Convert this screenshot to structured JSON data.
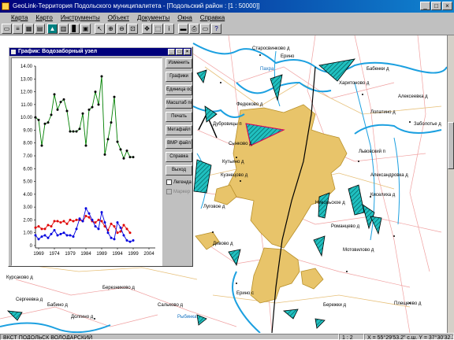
{
  "window": {
    "title": "GeoLink-Территория Подольского муниципалитета - [Подольский район : [1 : 50000]]",
    "buttons": [
      "_",
      "□",
      "×"
    ]
  },
  "menu": [
    "Карта",
    "Карто",
    "Инструменты",
    "Объект",
    "Документы",
    "Окна",
    "Справка"
  ],
  "graph_window": {
    "title": "График: Водозаборный узел",
    "buttons": [
      {
        "name": "edit-button",
        "label": "Изменить"
      },
      {
        "name": "charts-button",
        "label": "Графики"
      },
      {
        "name": "y-units-button",
        "label": "Единица оси Y"
      },
      {
        "name": "x-scale-button",
        "label": "Масштаб по X"
      },
      {
        "name": "print-button",
        "label": "Печать"
      },
      {
        "name": "metafile-button",
        "label": "Метафайл"
      },
      {
        "name": "bmp-file-button",
        "label": "BMP файл"
      },
      {
        "name": "help-button",
        "label": "Справка"
      },
      {
        "name": "exit-button",
        "label": "Выход"
      }
    ],
    "legend_label": "Легенда",
    "marker_label": "Маркер"
  },
  "map_labels": [
    "Старосвинково д",
    "Ерино",
    "Бабенки д",
    "Алексеевка д",
    "Харитоново д",
    "Федюково д",
    "Лопатино д",
    "Дубровицы п",
    "Заболотье д",
    "Львовский п",
    "Сынково д",
    "Кутьино д",
    "Александровка д",
    "Киселиха д",
    "Кузнецово д",
    "Луговое д",
    "Романцево д",
    "Мотовилово д",
    "Дивово д",
    "Плещеево д",
    "Бережки д",
    "Березниково д",
    "Сальково д",
    "Сергеевка д",
    "Ерино с",
    "Курсаково д",
    "Долгино д",
    "Бабино д",
    "Пахра",
    "Рыбинка",
    "Никольское д"
  ],
  "status": {
    "region": "ВКСТ ПОДОЛЬСК ВОЛОДАРСКИЙ",
    "scale": "1 : 2",
    "coords": "X = 55°29'53.2\" с.ш.   Y = 37°30'32.3\" в.д."
  },
  "chart_data": {
    "type": "line",
    "x_ticks": [
      "1969",
      "1974",
      "1979",
      "1984",
      "1989",
      "1994",
      "1999",
      "2004"
    ],
    "y_ticks": [
      "0",
      "1.00",
      "2.00",
      "3.00",
      "4.00",
      "5.00",
      "6.00",
      "7.00",
      "8.00",
      "9.00",
      "10.00",
      "11.00",
      "12.00",
      "13.00",
      "14.00"
    ],
    "ylim": [
      0,
      14
    ],
    "xlim": [
      1968,
      2005
    ],
    "grid": false,
    "series": [
      {
        "color": "#008000",
        "x": [
          1968,
          1969,
          1970,
          1971,
          1972,
          1973,
          1974,
          1975,
          1976,
          1977,
          1978,
          1979,
          1980,
          1981,
          1982,
          1983,
          1984,
          1985,
          1986,
          1987,
          1988,
          1989,
          1990,
          1991,
          1992,
          1993,
          1994,
          1995,
          1996,
          1997,
          1998,
          1999
        ],
        "values": [
          10.0,
          9.8,
          7.8,
          9.5,
          9.6,
          10.2,
          11.8,
          10.6,
          11.2,
          11.4,
          10.5,
          8.9,
          8.9,
          8.9,
          9.1,
          10.3,
          7.8,
          10.6,
          10.8,
          12.0,
          11.0,
          13.2,
          7.1,
          8.3,
          9.6,
          11.6,
          8.1,
          7.5,
          6.8,
          7.4,
          6.9,
          6.9
        ]
      },
      {
        "color": "#e00000",
        "x": [
          1968,
          1969,
          1970,
          1971,
          1972,
          1973,
          1974,
          1975,
          1976,
          1977,
          1978,
          1979,
          1980,
          1981,
          1982,
          1983,
          1984,
          1985,
          1986,
          1987,
          1988,
          1989,
          1990,
          1991,
          1992,
          1993,
          1994,
          1995,
          1996,
          1997,
          1998
        ],
        "values": [
          1.4,
          1.5,
          1.3,
          1.3,
          1.6,
          1.5,
          1.9,
          1.9,
          1.8,
          1.9,
          1.7,
          2.0,
          1.9,
          2.0,
          2.0,
          1.9,
          2.3,
          2.2,
          1.9,
          1.8,
          2.0,
          1.9,
          1.5,
          1.2,
          1.7,
          1.5,
          1.0,
          1.1,
          1.6,
          1.3,
          1.0
        ]
      },
      {
        "color": "#0000e0",
        "x": [
          1968,
          1969,
          1970,
          1971,
          1972,
          1973,
          1974,
          1975,
          1976,
          1977,
          1978,
          1979,
          1980,
          1981,
          1982,
          1983,
          1984,
          1985,
          1986,
          1987,
          1988,
          1989,
          1990,
          1991,
          1992,
          1993,
          1994,
          1995,
          1996,
          1997,
          1998,
          1999
        ],
        "values": [
          0.8,
          0.5,
          0.7,
          0.8,
          0.6,
          0.9,
          1.2,
          0.8,
          0.9,
          1.0,
          0.8,
          0.8,
          0.7,
          1.3,
          2.1,
          1.9,
          2.9,
          2.5,
          2.0,
          1.5,
          1.3,
          2.6,
          1.8,
          1.0,
          0.6,
          0.5,
          1.8,
          1.4,
          0.8,
          0.4,
          0.3,
          0.4
        ]
      }
    ]
  }
}
